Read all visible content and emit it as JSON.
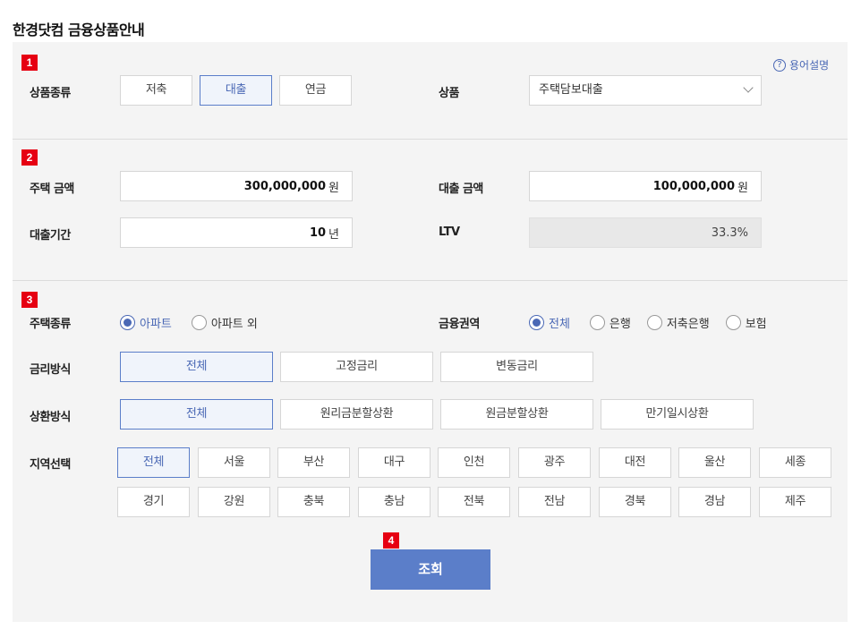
{
  "page": {
    "title": "한경닷컴 금융상품안내"
  },
  "help": {
    "label": "용어설명",
    "icon": "question-circle-icon"
  },
  "steps": [
    "1",
    "2",
    "3",
    "4"
  ],
  "section1": {
    "product_type_label": "상품종류",
    "product_types": [
      "저축",
      "대출",
      "연금"
    ],
    "selected_type": "대출",
    "product_label": "상품",
    "product_value": "주택담보대출"
  },
  "section2": {
    "house_amount_label": "주택 금액",
    "house_amount_value": "300,000,000",
    "house_amount_unit": "원",
    "loan_amount_label": "대출 금액",
    "loan_amount_value": "100,000,000",
    "loan_amount_unit": "원",
    "loan_period_label": "대출기간",
    "loan_period_value": "10",
    "loan_period_unit": "년",
    "ltv_label": "LTV",
    "ltv_value": "33.3%"
  },
  "section3": {
    "housing_type_label": "주택종류",
    "housing_types": [
      "아파트",
      "아파트 외"
    ],
    "housing_selected": "아파트",
    "finance_area_label": "금융권역",
    "finance_areas": [
      "전체",
      "은행",
      "저축은행",
      "보험"
    ],
    "finance_selected": "전체",
    "rate_method_label": "금리방식",
    "rate_methods": [
      "전체",
      "고정금리",
      "변동금리"
    ],
    "rate_selected": "전체",
    "repay_method_label": "상환방식",
    "repay_methods": [
      "전체",
      "원리금분할상환",
      "원금분할상환",
      "만기일시상환"
    ],
    "repay_selected": "전체",
    "region_label": "지역선택",
    "regions_row1": [
      "전체",
      "서울",
      "부산",
      "대구",
      "인천",
      "광주",
      "대전",
      "울산",
      "세종"
    ],
    "regions_row2": [
      "경기",
      "강원",
      "충북",
      "충남",
      "전북",
      "전남",
      "경북",
      "경남",
      "제주"
    ],
    "region_selected": "전체"
  },
  "search": {
    "label": "조회"
  },
  "colors": {
    "accent": "#5b7ec9",
    "step_badge": "#e60012",
    "panel_bg": "#f4f4f4"
  }
}
